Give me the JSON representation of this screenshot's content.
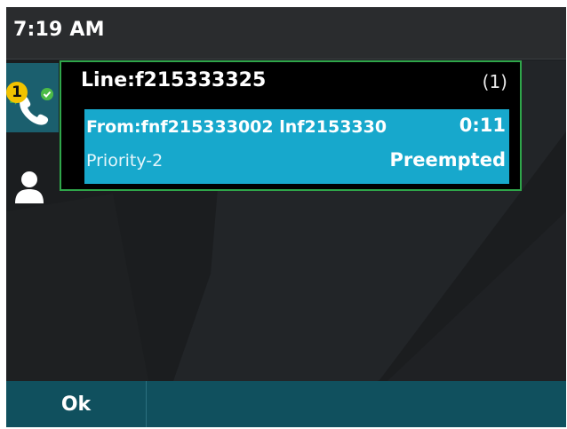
{
  "status_bar": {
    "time": "7:19 AM"
  },
  "sidebar": {
    "line_badge_count": "1",
    "line_icon": "phone-handset-icon",
    "contact_icon": "person-icon"
  },
  "popup": {
    "line_label": "Line:f215333325",
    "call_count": "(1)",
    "call": {
      "from": "From:fnf215333002 lnf2153330",
      "timer": "0:11",
      "priority": "Priority-2",
      "status": "Preempted"
    }
  },
  "softkeys": {
    "ok_label": "Ok"
  },
  "colors": {
    "accent": "#17a8cc",
    "popup_border": "#2fa64a",
    "softkey_bg": "#10505e",
    "badge": "#f3c300"
  }
}
